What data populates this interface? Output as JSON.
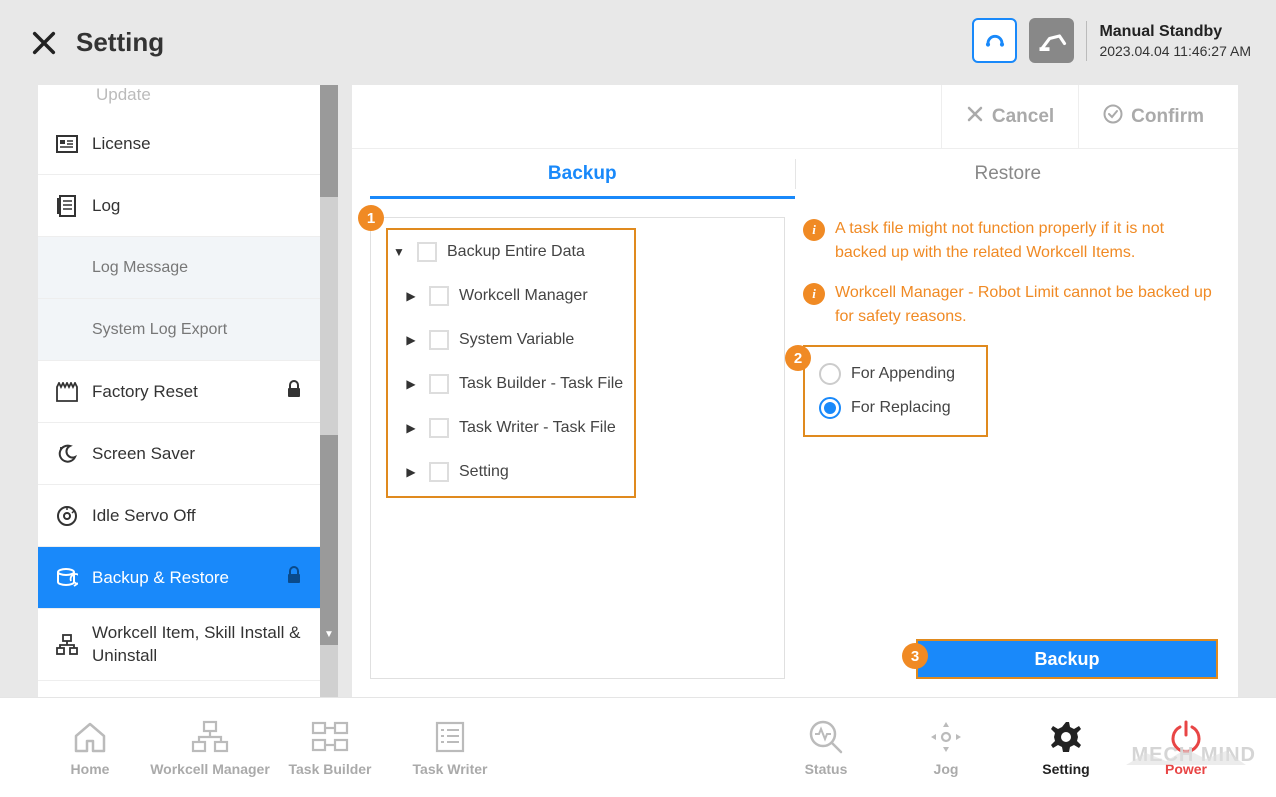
{
  "header": {
    "title": "Setting",
    "status_title": "Manual Standby",
    "status_time": "2023.04.04 11:46:27 AM"
  },
  "sidebar": {
    "update_partial": "Update",
    "items": [
      {
        "label": "License"
      },
      {
        "label": "Log"
      },
      {
        "label": "Log Message"
      },
      {
        "label": "System Log Export"
      },
      {
        "label": "Factory Reset"
      },
      {
        "label": "Screen Saver"
      },
      {
        "label": "Idle Servo Off"
      },
      {
        "label": "Backup & Restore"
      },
      {
        "label": "Workcell Item, Skill Install & Uninstall"
      }
    ]
  },
  "buttons": {
    "cancel": "Cancel",
    "confirm": "Confirm",
    "backup": "Backup"
  },
  "tabs": {
    "backup": "Backup",
    "restore": "Restore"
  },
  "tree": {
    "root": "Backup Entire Data",
    "children": [
      "Workcell Manager",
      "System Variable",
      "Task Builder - Task File",
      "Task Writer - Task File",
      "Setting"
    ]
  },
  "info": {
    "msg1": "A task file might not function properly if it is not backed up with the related Workcell Items.",
    "msg2": "Workcell Manager - Robot Limit cannot be backed up for safety reasons."
  },
  "radio": {
    "opt1": "For Appending",
    "opt2": "For Replacing"
  },
  "annotations": {
    "n1": "1",
    "n2": "2",
    "n3": "3"
  },
  "bottom": {
    "home": "Home",
    "wm": "Workcell Manager",
    "tb": "Task Builder",
    "tw": "Task Writer",
    "status": "Status",
    "jog": "Jog",
    "setting": "Setting",
    "power": "Power"
  },
  "watermark": {
    "line1": "MECH MIND"
  }
}
